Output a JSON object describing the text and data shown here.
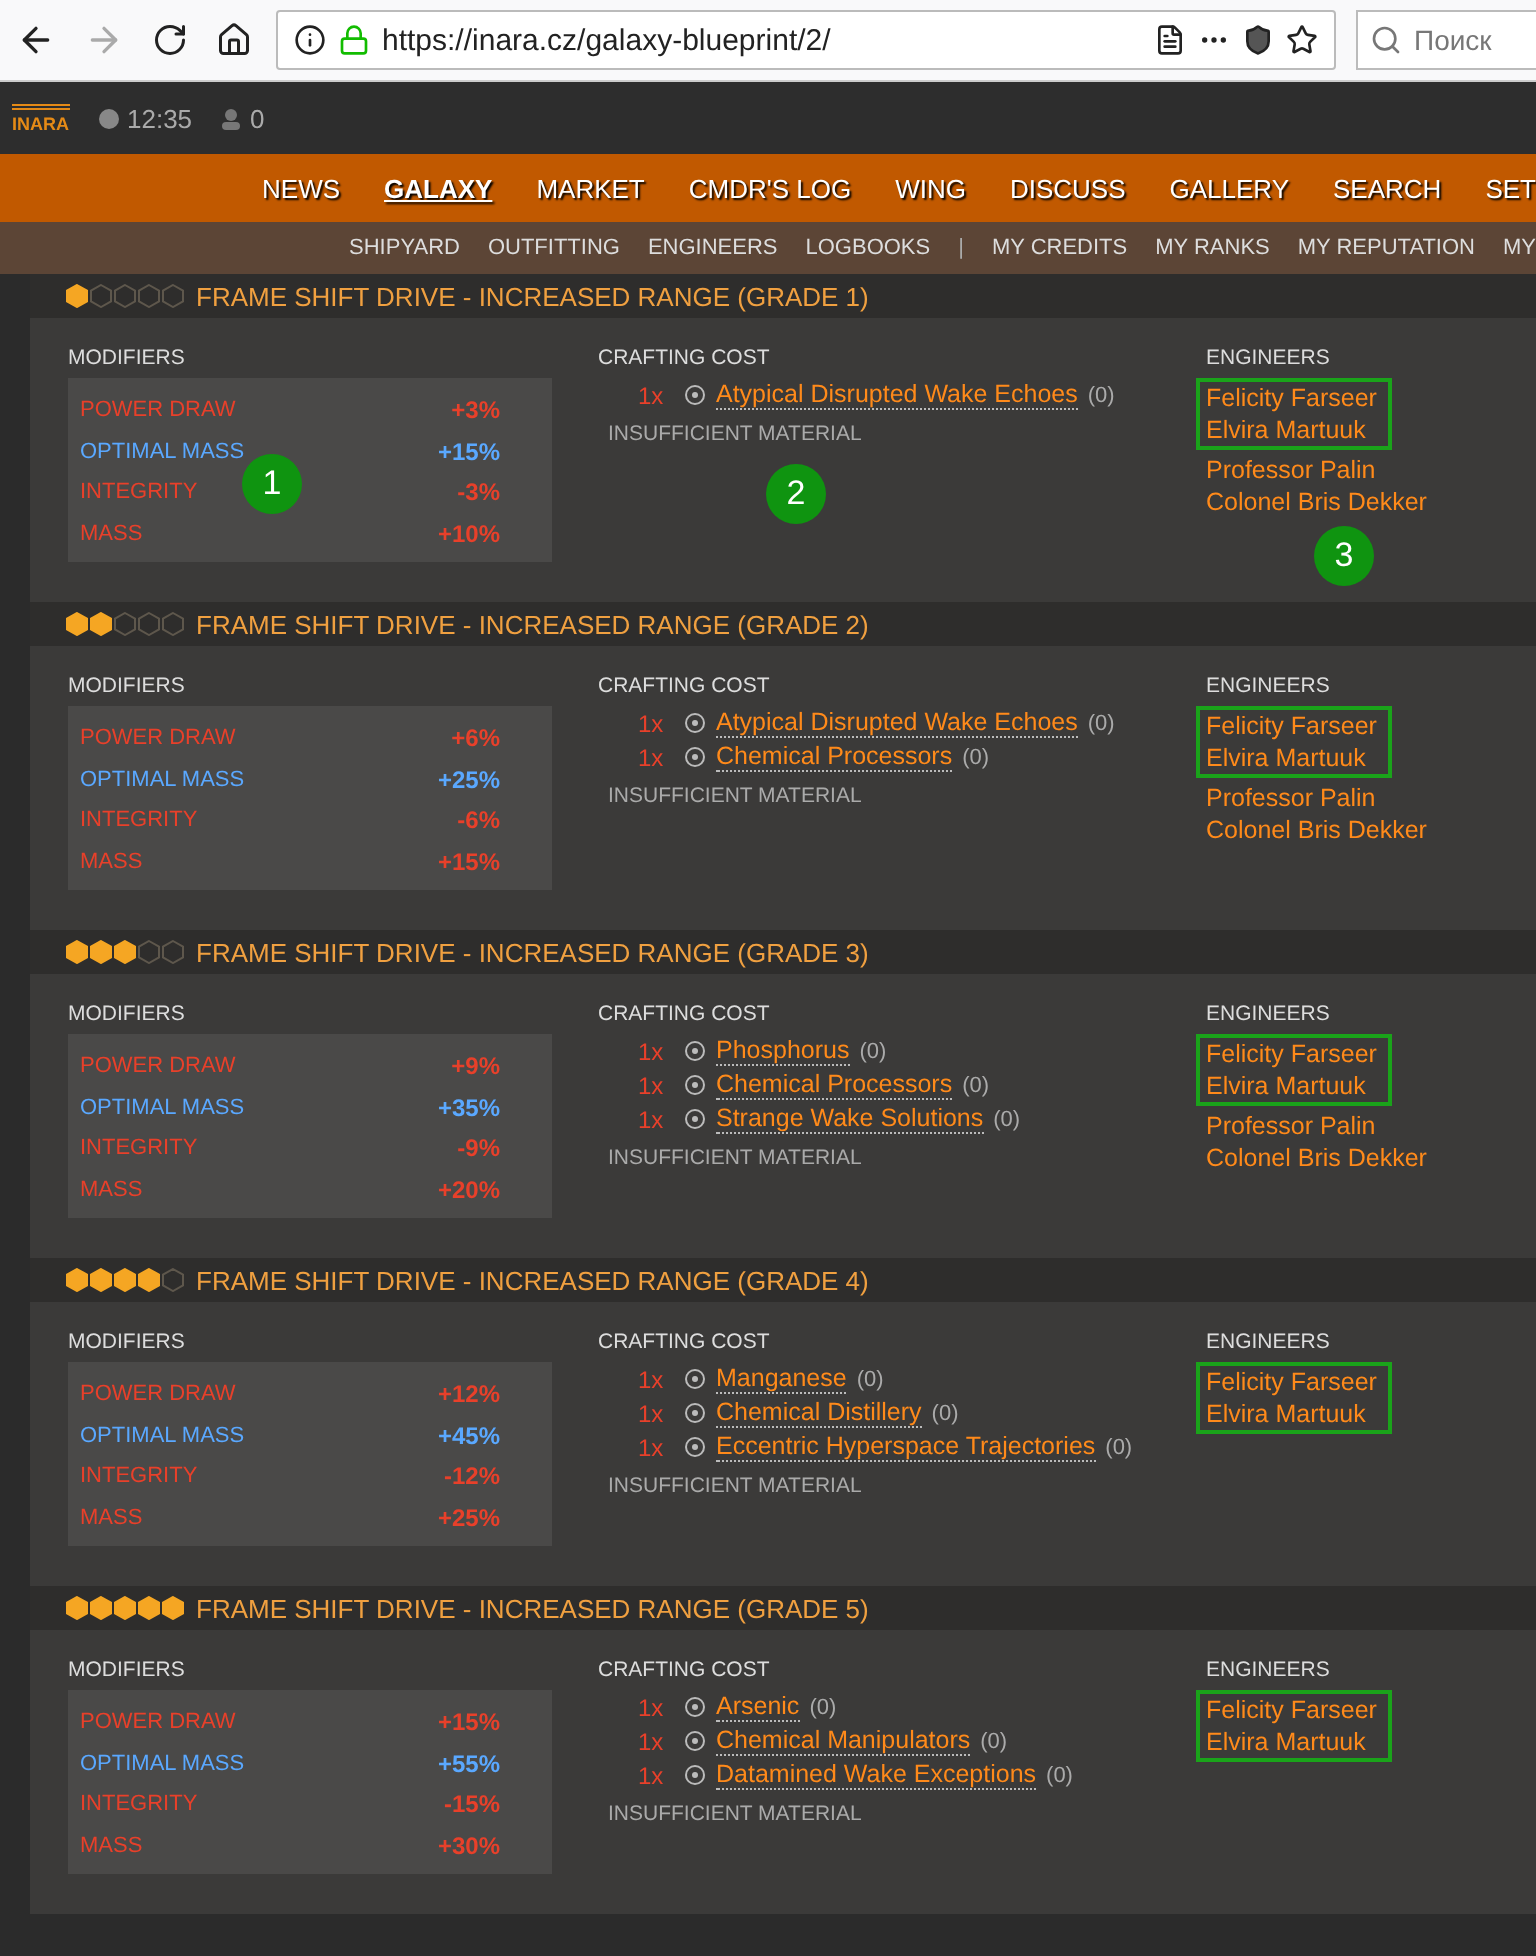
{
  "browser": {
    "url": "https://inara.cz/galaxy-blueprint/2/",
    "search_placeholder": "Поиск"
  },
  "topbar": {
    "logo": "INARA",
    "time": "12:35",
    "count": "0"
  },
  "nav": [
    {
      "label": "NEWS",
      "selected": false
    },
    {
      "label": "GALAXY",
      "selected": true
    },
    {
      "label": "MARKET",
      "selected": false
    },
    {
      "label": "CMDR'S LOG",
      "selected": false
    },
    {
      "label": "WING",
      "selected": false
    },
    {
      "label": "DISCUSS",
      "selected": false
    },
    {
      "label": "GALLERY",
      "selected": false
    },
    {
      "label": "SEARCH",
      "selected": false
    },
    {
      "label": "SET",
      "selected": false
    }
  ],
  "subnav": [
    "SHIPYARD",
    "OUTFITTING",
    "ENGINEERS",
    "LOGBOOKS",
    "|",
    "MY CREDITS",
    "MY RANKS",
    "MY REPUTATION",
    "MY"
  ],
  "blueprints": [
    {
      "title": "FRAME SHIFT DRIVE - INCREASED RANGE (GRADE 1)",
      "stars": 1,
      "modifiers_label": "MODIFIERS",
      "crafting_label": "CRAFTING COST",
      "engineers_label": "ENGINEERS",
      "status": "INSUFFICIENT MATERIAL",
      "modifiers": [
        {
          "name": "POWER DRAW",
          "value": "+3%",
          "good": false
        },
        {
          "name": "OPTIMAL MASS",
          "value": "+15%",
          "good": true
        },
        {
          "name": "INTEGRITY",
          "value": "-3%",
          "good": false
        },
        {
          "name": "MASS",
          "value": "+10%",
          "good": false
        }
      ],
      "materials": [
        {
          "qty": "1x",
          "name": "Atypical Disrupted Wake Echoes",
          "owned": "(0)"
        }
      ],
      "engineers": [
        {
          "name": "Felicity Farseer",
          "highlighted": true
        },
        {
          "name": "Elvira Martuuk",
          "highlighted": true
        },
        {
          "name": "Professor Palin",
          "highlighted": false
        },
        {
          "name": "Colonel Bris Dekker",
          "highlighted": false
        }
      ],
      "markers": [
        "1",
        "2",
        "3"
      ]
    },
    {
      "title": "FRAME SHIFT DRIVE - INCREASED RANGE (GRADE 2)",
      "stars": 2,
      "modifiers_label": "MODIFIERS",
      "crafting_label": "CRAFTING COST",
      "engineers_label": "ENGINEERS",
      "status": "INSUFFICIENT MATERIAL",
      "modifiers": [
        {
          "name": "POWER DRAW",
          "value": "+6%",
          "good": false
        },
        {
          "name": "OPTIMAL MASS",
          "value": "+25%",
          "good": true
        },
        {
          "name": "INTEGRITY",
          "value": "-6%",
          "good": false
        },
        {
          "name": "MASS",
          "value": "+15%",
          "good": false
        }
      ],
      "materials": [
        {
          "qty": "1x",
          "name": "Atypical Disrupted Wake Echoes",
          "owned": "(0)"
        },
        {
          "qty": "1x",
          "name": "Chemical Processors",
          "owned": "(0)"
        }
      ],
      "engineers": [
        {
          "name": "Felicity Farseer",
          "highlighted": true
        },
        {
          "name": "Elvira Martuuk",
          "highlighted": true
        },
        {
          "name": "Professor Palin",
          "highlighted": false
        },
        {
          "name": "Colonel Bris Dekker",
          "highlighted": false
        }
      ]
    },
    {
      "title": "FRAME SHIFT DRIVE - INCREASED RANGE (GRADE 3)",
      "stars": 3,
      "modifiers_label": "MODIFIERS",
      "crafting_label": "CRAFTING COST",
      "engineers_label": "ENGINEERS",
      "status": "INSUFFICIENT MATERIAL",
      "modifiers": [
        {
          "name": "POWER DRAW",
          "value": "+9%",
          "good": false
        },
        {
          "name": "OPTIMAL MASS",
          "value": "+35%",
          "good": true
        },
        {
          "name": "INTEGRITY",
          "value": "-9%",
          "good": false
        },
        {
          "name": "MASS",
          "value": "+20%",
          "good": false
        }
      ],
      "materials": [
        {
          "qty": "1x",
          "name": "Phosphorus",
          "owned": "(0)"
        },
        {
          "qty": "1x",
          "name": "Chemical Processors",
          "owned": "(0)"
        },
        {
          "qty": "1x",
          "name": "Strange Wake Solutions",
          "owned": "(0)"
        }
      ],
      "engineers": [
        {
          "name": "Felicity Farseer",
          "highlighted": true
        },
        {
          "name": "Elvira Martuuk",
          "highlighted": true
        },
        {
          "name": "Professor Palin",
          "highlighted": false
        },
        {
          "name": "Colonel Bris Dekker",
          "highlighted": false
        }
      ]
    },
    {
      "title": "FRAME SHIFT DRIVE - INCREASED RANGE (GRADE 4)",
      "stars": 4,
      "modifiers_label": "MODIFIERS",
      "crafting_label": "CRAFTING COST",
      "engineers_label": "ENGINEERS",
      "status": "INSUFFICIENT MATERIAL",
      "modifiers": [
        {
          "name": "POWER DRAW",
          "value": "+12%",
          "good": false
        },
        {
          "name": "OPTIMAL MASS",
          "value": "+45%",
          "good": true
        },
        {
          "name": "INTEGRITY",
          "value": "-12%",
          "good": false
        },
        {
          "name": "MASS",
          "value": "+25%",
          "good": false
        }
      ],
      "materials": [
        {
          "qty": "1x",
          "name": "Manganese",
          "owned": "(0)"
        },
        {
          "qty": "1x",
          "name": "Chemical Distillery",
          "owned": "(0)"
        },
        {
          "qty": "1x",
          "name": "Eccentric Hyperspace Trajectories",
          "owned": "(0)"
        }
      ],
      "engineers": [
        {
          "name": "Felicity Farseer",
          "highlighted": true
        },
        {
          "name": "Elvira Martuuk",
          "highlighted": true
        }
      ]
    },
    {
      "title": "FRAME SHIFT DRIVE - INCREASED RANGE (GRADE 5)",
      "stars": 5,
      "modifiers_label": "MODIFIERS",
      "crafting_label": "CRAFTING COST",
      "engineers_label": "ENGINEERS",
      "status": "INSUFFICIENT MATERIAL",
      "modifiers": [
        {
          "name": "POWER DRAW",
          "value": "+15%",
          "good": false
        },
        {
          "name": "OPTIMAL MASS",
          "value": "+55%",
          "good": true
        },
        {
          "name": "INTEGRITY",
          "value": "-15%",
          "good": false
        },
        {
          "name": "MASS",
          "value": "+30%",
          "good": false
        }
      ],
      "materials": [
        {
          "qty": "1x",
          "name": "Arsenic",
          "owned": "(0)"
        },
        {
          "qty": "1x",
          "name": "Chemical Manipulators",
          "owned": "(0)"
        },
        {
          "qty": "1x",
          "name": "Datamined Wake Exceptions",
          "owned": "(0)"
        }
      ],
      "engineers": [
        {
          "name": "Felicity Farseer",
          "highlighted": true
        },
        {
          "name": "Elvira Martuuk",
          "highlighted": true
        }
      ]
    }
  ]
}
